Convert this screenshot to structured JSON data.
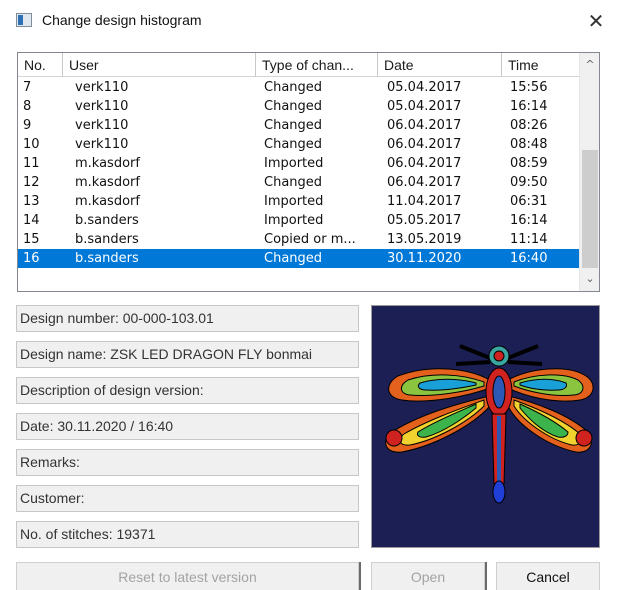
{
  "window": {
    "title": "Change design histogram",
    "close_glyph": "✕",
    "icon": "app-window-icon"
  },
  "list": {
    "columns": [
      "No.",
      "User",
      "Type of chan...",
      "Date",
      "Time"
    ],
    "rows": [
      {
        "no": "7",
        "user": "verk110",
        "type": "Changed",
        "date": "05.04.2017",
        "time": "15:56"
      },
      {
        "no": "8",
        "user": "verk110",
        "type": "Changed",
        "date": "05.04.2017",
        "time": "16:14"
      },
      {
        "no": "9",
        "user": "verk110",
        "type": "Changed",
        "date": "06.04.2017",
        "time": "08:26"
      },
      {
        "no": "10",
        "user": "verk110",
        "type": "Changed",
        "date": "06.04.2017",
        "time": "08:48"
      },
      {
        "no": "11",
        "user": "m.kasdorf",
        "type": "Imported",
        "date": "06.04.2017",
        "time": "08:59"
      },
      {
        "no": "12",
        "user": "m.kasdorf",
        "type": "Changed",
        "date": "06.04.2017",
        "time": "09:50"
      },
      {
        "no": "13",
        "user": "m.kasdorf",
        "type": "Imported",
        "date": "11.04.2017",
        "time": "06:31"
      },
      {
        "no": "14",
        "user": "b.sanders",
        "type": "Imported",
        "date": "05.05.2017",
        "time": "16:14"
      },
      {
        "no": "15",
        "user": "b.sanders",
        "type": "Copied or m...",
        "date": "13.05.2019",
        "time": "11:14"
      },
      {
        "no": "16",
        "user": "b.sanders",
        "type": "Changed",
        "date": "30.11.2020",
        "time": "16:40"
      }
    ],
    "selected_row": 9,
    "scroll_up_glyph": "^",
    "scroll_down_glyph": "⌄"
  },
  "details": {
    "design_number": "Design number: 00-000-103.01",
    "design_name": "Design name: ZSK LED DRAGON FLY bonmai",
    "description": "Description of design version:",
    "date": "Date: 30.11.2020 / 16:40",
    "remarks": "Remarks:",
    "customer": "Customer:",
    "stitches": "No. of stitches: 19371"
  },
  "preview": {
    "subject": "dragonfly-embroidery-preview",
    "background_color": "#1c1f54"
  },
  "buttons": {
    "reset": "Reset to latest version",
    "open": "Open",
    "cancel": "Cancel"
  },
  "colors": {
    "selection": "#0078d7",
    "dialog_bg": "#f0f0f0"
  }
}
